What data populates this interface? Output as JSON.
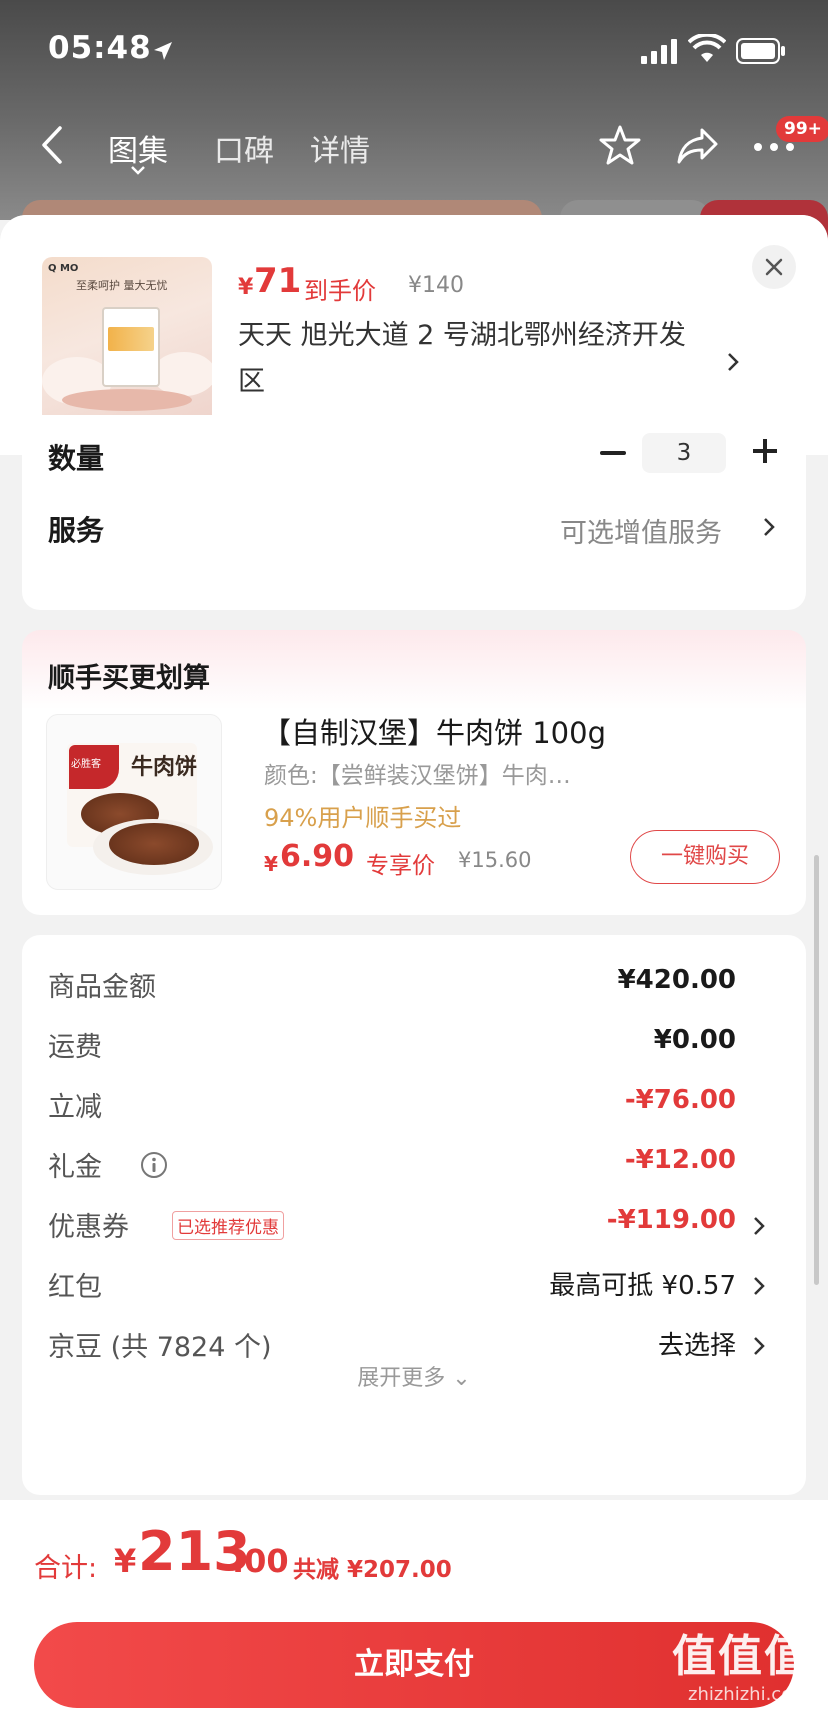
{
  "status": {
    "time": "05:48"
  },
  "nav": {
    "tabs": [
      "图集",
      "口碑",
      "详情"
    ],
    "badge": "99+"
  },
  "summary": {
    "price_symbol": "¥",
    "price": "71",
    "price_tag": "到手价",
    "original_price": "¥140",
    "address": "天天  旭光大道 2 号湖北鄂州经济开发区",
    "thumb_brand": "Q MO",
    "thumb_slogan": "至柔呵护 量大无忧"
  },
  "quantity": {
    "label": "数量",
    "value": "3"
  },
  "service": {
    "label": "服务",
    "hint": "可选增值服务"
  },
  "addon": {
    "title": "顺手买更划算",
    "name": "【自制汉堡】牛肉饼 100g",
    "spec": "颜色:【尝鲜装汉堡饼】牛肉…",
    "social": "94%用户顺手买过",
    "price_symbol": "¥",
    "price": "6.90",
    "price_tag": "专享价",
    "original_price": "¥15.60",
    "buy_label": "一键购买",
    "bag_brand": "必胜客",
    "bag_title": "牛肉饼"
  },
  "fees": [
    {
      "label": "商品金额",
      "value": "¥420.00"
    },
    {
      "label": "运费",
      "value": "¥0.00"
    },
    {
      "label": "立减",
      "value": "-¥76.00"
    },
    {
      "label": "礼金",
      "value": "-¥12.00"
    },
    {
      "label": "优惠券",
      "tag": "已选推荐优惠",
      "value": "-¥119.00"
    },
    {
      "label": "红包",
      "value": "最高可抵 ¥0.57"
    },
    {
      "label": "京豆 (共 7824 个)",
      "value": "去选择"
    }
  ],
  "expand_label": "展开更多 ⌄",
  "footer": {
    "total_label": "合计:",
    "total_symbol": "¥",
    "total_int": "213",
    "total_dec": ".00",
    "total_save": "共减 ¥207.00",
    "pay_label": "立即支付"
  },
  "watermark": {
    "big": "值值值",
    "small": "zhizhizhi.com"
  },
  "colors": {
    "accent": "#e23a3a",
    "muted": "#888888",
    "gold": "#d8a04c"
  }
}
